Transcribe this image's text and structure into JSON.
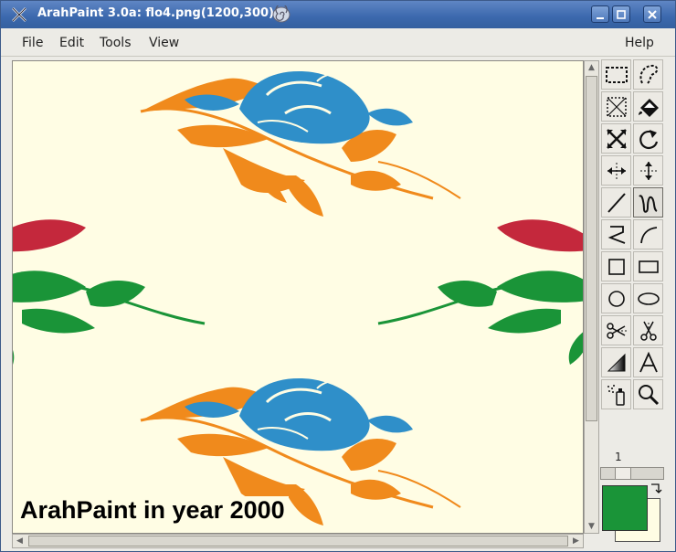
{
  "window": {
    "title": "ArahPaint 3.0a: flo4.png(1200,300)"
  },
  "menu": {
    "file": "File",
    "edit": "Edit",
    "tools": "Tools",
    "view": "View",
    "help": "Help"
  },
  "canvas": {
    "caption": "ArahPaint in year 2000",
    "colors": {
      "background": "#fffde4",
      "rose_blue": "#2f8fc9",
      "leaves_orange": "#f08a1c",
      "rose_red": "#c4283c",
      "leaves_green": "#1a9438"
    }
  },
  "toolbox": {
    "tools": [
      {
        "name": "rect-select-icon"
      },
      {
        "name": "lasso-select-icon"
      },
      {
        "name": "crop-icon"
      },
      {
        "name": "fill-bucket-icon"
      },
      {
        "name": "resize-icon"
      },
      {
        "name": "rotate-icon"
      },
      {
        "name": "flip-horizontal-icon"
      },
      {
        "name": "flip-vertical-icon"
      },
      {
        "name": "line-icon"
      },
      {
        "name": "freehand-icon"
      },
      {
        "name": "polyline-icon"
      },
      {
        "name": "curve-icon"
      },
      {
        "name": "square-icon"
      },
      {
        "name": "rectangle-icon"
      },
      {
        "name": "circle-icon"
      },
      {
        "name": "ellipse-icon"
      },
      {
        "name": "cut-icon"
      },
      {
        "name": "scissors-icon"
      },
      {
        "name": "gradient-icon"
      },
      {
        "name": "text-icon"
      },
      {
        "name": "spray-icon"
      },
      {
        "name": "zoom-icon"
      }
    ],
    "brush_size": "1",
    "foreground_color": "#1a9438",
    "background_color": "#fffde4"
  }
}
